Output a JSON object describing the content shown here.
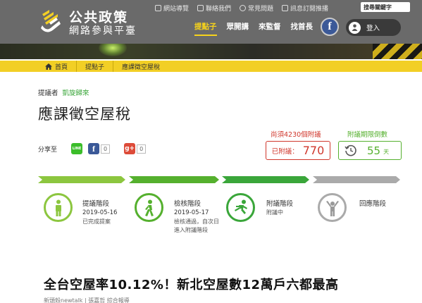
{
  "header": {
    "logo_title": "公共政策",
    "logo_subtitle": "網路參與平臺",
    "util_links": [
      "網站導覽",
      "聯絡我們",
      "常見問題",
      "訊息訂閱推播"
    ],
    "search_placeholder": "搜尋關鍵字",
    "nav": [
      "提點子",
      "眾開講",
      "來監督",
      "找首長"
    ],
    "active_nav": "提點子",
    "facebook_glyph": "f",
    "login_label": "登入"
  },
  "breadcrumb": [
    "首頁",
    "提點子",
    "應課徵空屋稅"
  ],
  "proposal": {
    "proposer_label": "提議者",
    "proposer_name": "凱旋歸來",
    "title": "應課徵空屋稅",
    "share_label": "分享至",
    "share": {
      "line_glyph": "LINE",
      "facebook_glyph": "f",
      "facebook_count": "0",
      "google_glyph": "g+",
      "google_count": "0"
    },
    "needed_text": "尚須4230個附議",
    "deadline_label": "附議期限倒數",
    "signatures_label": "已附議：",
    "signatures_value": "770",
    "days_value": "55",
    "days_unit": "天"
  },
  "stages": [
    {
      "name": "提議階段",
      "date": "2019-05-16",
      "status": "已完成提案",
      "color": "#8cc63f"
    },
    {
      "name": "檢核階段",
      "date": "2019-05-17",
      "status": "檢核通過，自次日進入附議階段",
      "color": "#55b02e"
    },
    {
      "name": "附議階段",
      "date": "",
      "status": "附議中",
      "color": "#3aa63a"
    },
    {
      "name": "回應階段",
      "date": "",
      "status": "",
      "color": "#aaaaaa"
    }
  ],
  "article": {
    "title": "全台空屋率10.12%！新北空屋數12萬戶六都最高",
    "source": "新頭殼newtalk | 張嘉哲 綜合報導"
  },
  "colors": {
    "header_bg": "#6a6a6a",
    "accent_yellow": "#f2cf25",
    "needed_red": "#d0372c",
    "deadline_green": "#55b02e"
  }
}
